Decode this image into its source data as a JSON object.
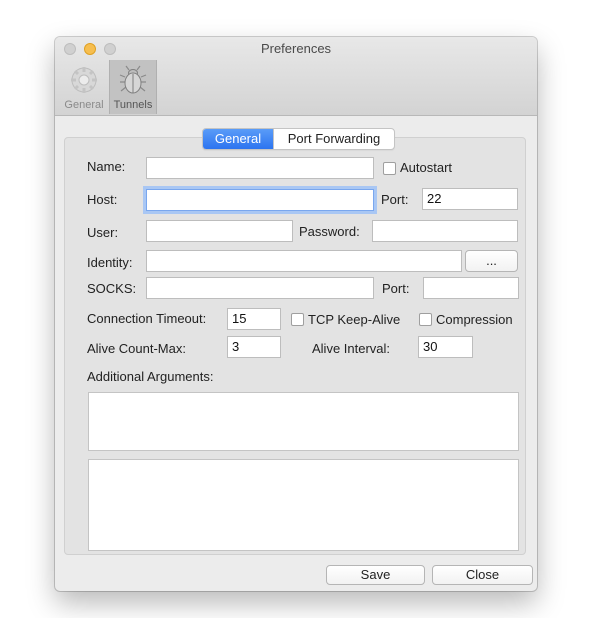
{
  "window": {
    "title": "Preferences"
  },
  "toolbar": {
    "general_label": "General",
    "tunnels_label": "Tunnels"
  },
  "tabs": [
    {
      "label": "General",
      "selected": true
    },
    {
      "label": "Port Forwarding",
      "selected": false
    }
  ],
  "form": {
    "name_label": "Name:",
    "name_value": "",
    "autostart_label": "Autostart",
    "autostart_checked": false,
    "host_label": "Host:",
    "host_value": "",
    "port_label": "Port:",
    "port_value": "22",
    "user_label": "User:",
    "user_value": "",
    "password_label": "Password:",
    "password_value": "",
    "identity_label": "Identity:",
    "identity_value": "",
    "browse_label": "...",
    "socks_label": "SOCKS:",
    "socks_value": "",
    "socks_port_label": "Port:",
    "socks_port_value": "",
    "timeout_label": "Connection Timeout:",
    "timeout_value": "15",
    "keepalive_label": "TCP Keep-Alive",
    "keepalive_checked": false,
    "compression_label": "Compression",
    "compression_checked": false,
    "alive_count_label": "Alive Count-Max:",
    "alive_count_value": "3",
    "alive_interval_label": "Alive Interval:",
    "alive_interval_value": "30",
    "additional_args_label": "Additional Arguments:"
  },
  "footer": {
    "save_label": "Save",
    "close_label": "Close"
  },
  "colors": {
    "accent": "#2c74f0",
    "focus_ring": "#a9c7f4",
    "window_bg": "#ececec"
  }
}
